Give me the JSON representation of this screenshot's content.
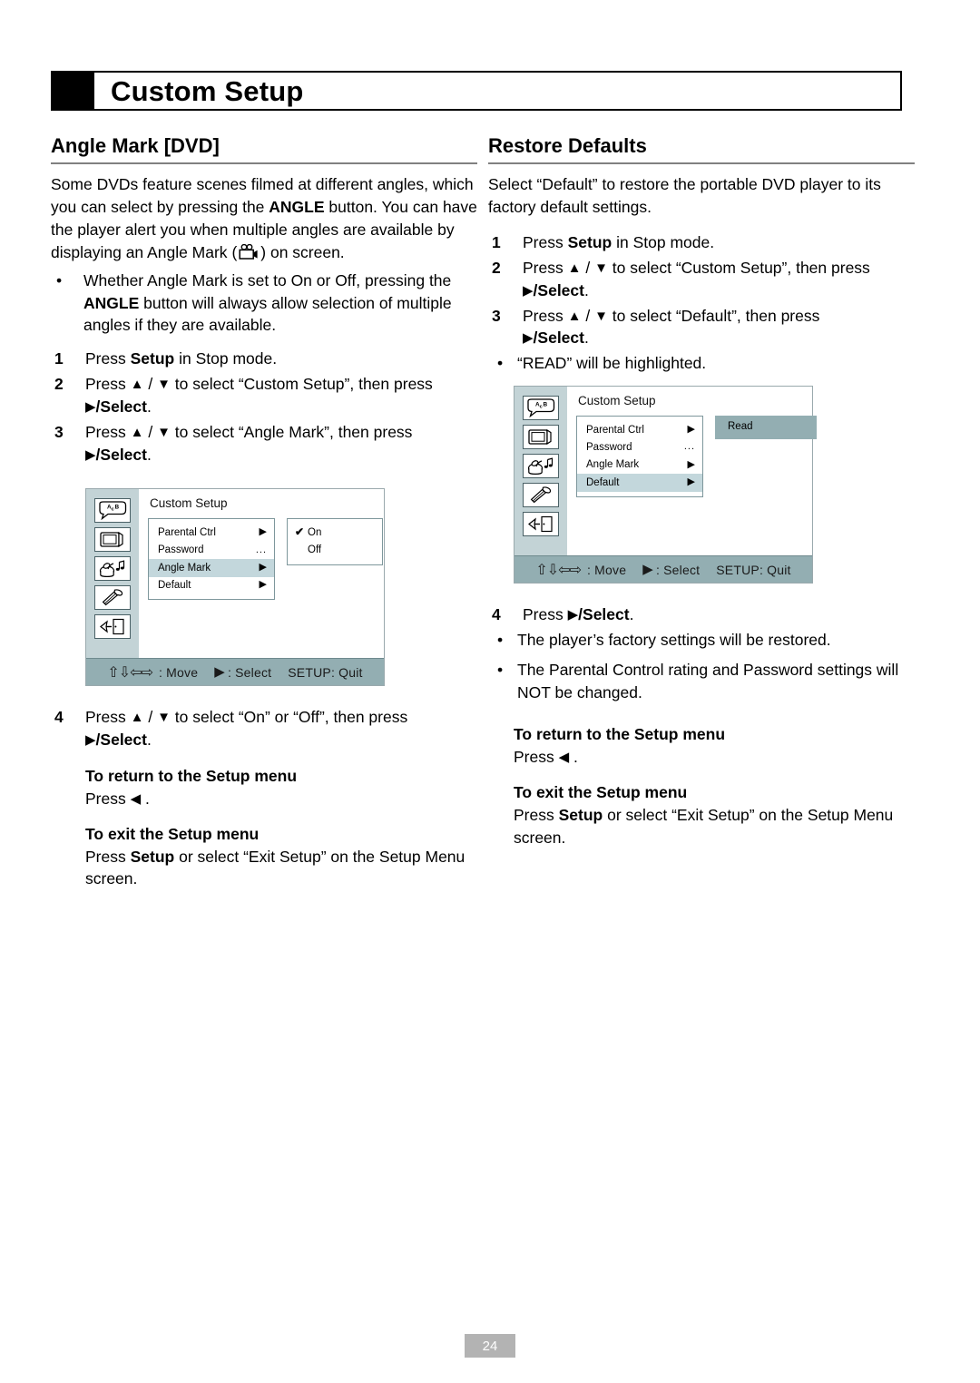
{
  "header": {
    "title": "Custom Setup"
  },
  "left_column": {
    "section_title": "Angle Mark [DVD]",
    "intro_line1": "Some DVDs feature scenes filmed at different angles,",
    "intro_line2_a": "which you can select by pressing the ",
    "intro_line2_b": "ANGLE",
    "intro_line2_c": " button.",
    "intro_line3": "You can have the player alert you when multiple",
    "intro_line4": "angles are available by displaying an Angle Mark",
    "intro_line5_a": "(",
    "intro_line5_b": ") on screen.",
    "bullet1_a": "Whether Angle Mark is set to On or Off, pressing the ",
    "bullet1_b": "ANGLE",
    "bullet1_c": " button will always allow selection of multiple angles if they are available.",
    "steps": [
      {
        "num": "1",
        "text_a": "Press ",
        "bold": "Setup",
        "text_b": " in Stop mode."
      },
      {
        "num": "2",
        "text_a": "Press ",
        "text_b": " to select “Custom Setup”, then press ",
        "bold": "/Select",
        "text_c": "."
      },
      {
        "num": "3",
        "text_a": "Press ",
        "text_b": " to select “Angle Mark”, then press ",
        "bold": "/Select",
        "text_c": "."
      }
    ],
    "step4": {
      "num": "4",
      "text_a": "Press ",
      "text_b": " to select “On” or “Off”, then press ",
      "bold": "/Select",
      "text_c": "."
    },
    "return_heading": "To return to the Setup menu",
    "return_text_a": "Press ",
    "return_text_b": ".",
    "exit_heading": "To exit the Setup menu",
    "exit_text_a": "Press ",
    "exit_bold": "Setup",
    "exit_text_b": " or select “Exit Setup” on the Setup Menu screen."
  },
  "right_column": {
    "section_title": "Restore Defaults",
    "intro": "Select “Default” to restore the portable DVD player to its factory default settings.",
    "steps": [
      {
        "num": "1",
        "text_a": "Press ",
        "bold": "Setup",
        "text_b": " in Stop mode."
      },
      {
        "num": "2",
        "text_a": "Press ",
        "text_b": " to select “Custom Setup”, then press ",
        "bold": "/Select",
        "text_c": "."
      },
      {
        "num": "3",
        "text_a": "Press ",
        "text_b": " to select “Default”, then press ",
        "bold": "/Select",
        "text_c": "."
      }
    ],
    "step3_bullet": "“READ” will be highlighted.",
    "step4": {
      "num": "4",
      "text_a": "Press ",
      "bold": "/Select",
      "text_b": "."
    },
    "step4_bullets": [
      "The player’s factory settings will be restored.",
      "The Parental Control rating and Password settings will NOT be changed."
    ],
    "return_heading": "To return to the Setup menu",
    "return_text_a": "Press ",
    "return_text_b": ".",
    "exit_heading": "To exit the Setup menu",
    "exit_text_a": "Press ",
    "exit_bold": "Setup",
    "exit_text_b": " or select “Exit Setup” on the Setup Menu screen."
  },
  "osd_angle": {
    "heading": "Custom Setup",
    "menu_rows": [
      {
        "label": "Parental Ctrl",
        "marker": "tri",
        "selected": false
      },
      {
        "label": "Password",
        "marker": "dots",
        "selected": false
      },
      {
        "label": "Angle Mark",
        "marker": "tri",
        "selected": true
      },
      {
        "label": "Default",
        "marker": "tri",
        "selected": false
      }
    ],
    "submenu": [
      {
        "label": "On",
        "checked": true
      },
      {
        "label": "Off",
        "checked": false
      }
    ],
    "footer": {
      "move_label": ": Move",
      "select_label": ": Select",
      "quit_label": "SETUP: Quit"
    }
  },
  "osd_default": {
    "heading": "Custom Setup",
    "menu_rows": [
      {
        "label": "Parental Ctrl",
        "marker": "tri",
        "selected": false
      },
      {
        "label": "Password",
        "marker": "dots",
        "selected": false
      },
      {
        "label": "Angle Mark",
        "marker": "tri",
        "selected": false
      },
      {
        "label": "Default",
        "marker": "tri",
        "selected": true
      }
    ],
    "read_label": "Read",
    "footer": {
      "move_label": ": Move",
      "select_label": ": Select",
      "quit_label": "SETUP: Quit"
    }
  },
  "footer": {
    "page_number": "24"
  },
  "colors": {
    "rail": "#c3d3d6",
    "highlight": "#c3d7dc",
    "read_box": "#93aeb2",
    "osd_footer": "#93aeb2",
    "rule": "#808080",
    "page_num_bg": "#b3b3b3"
  }
}
